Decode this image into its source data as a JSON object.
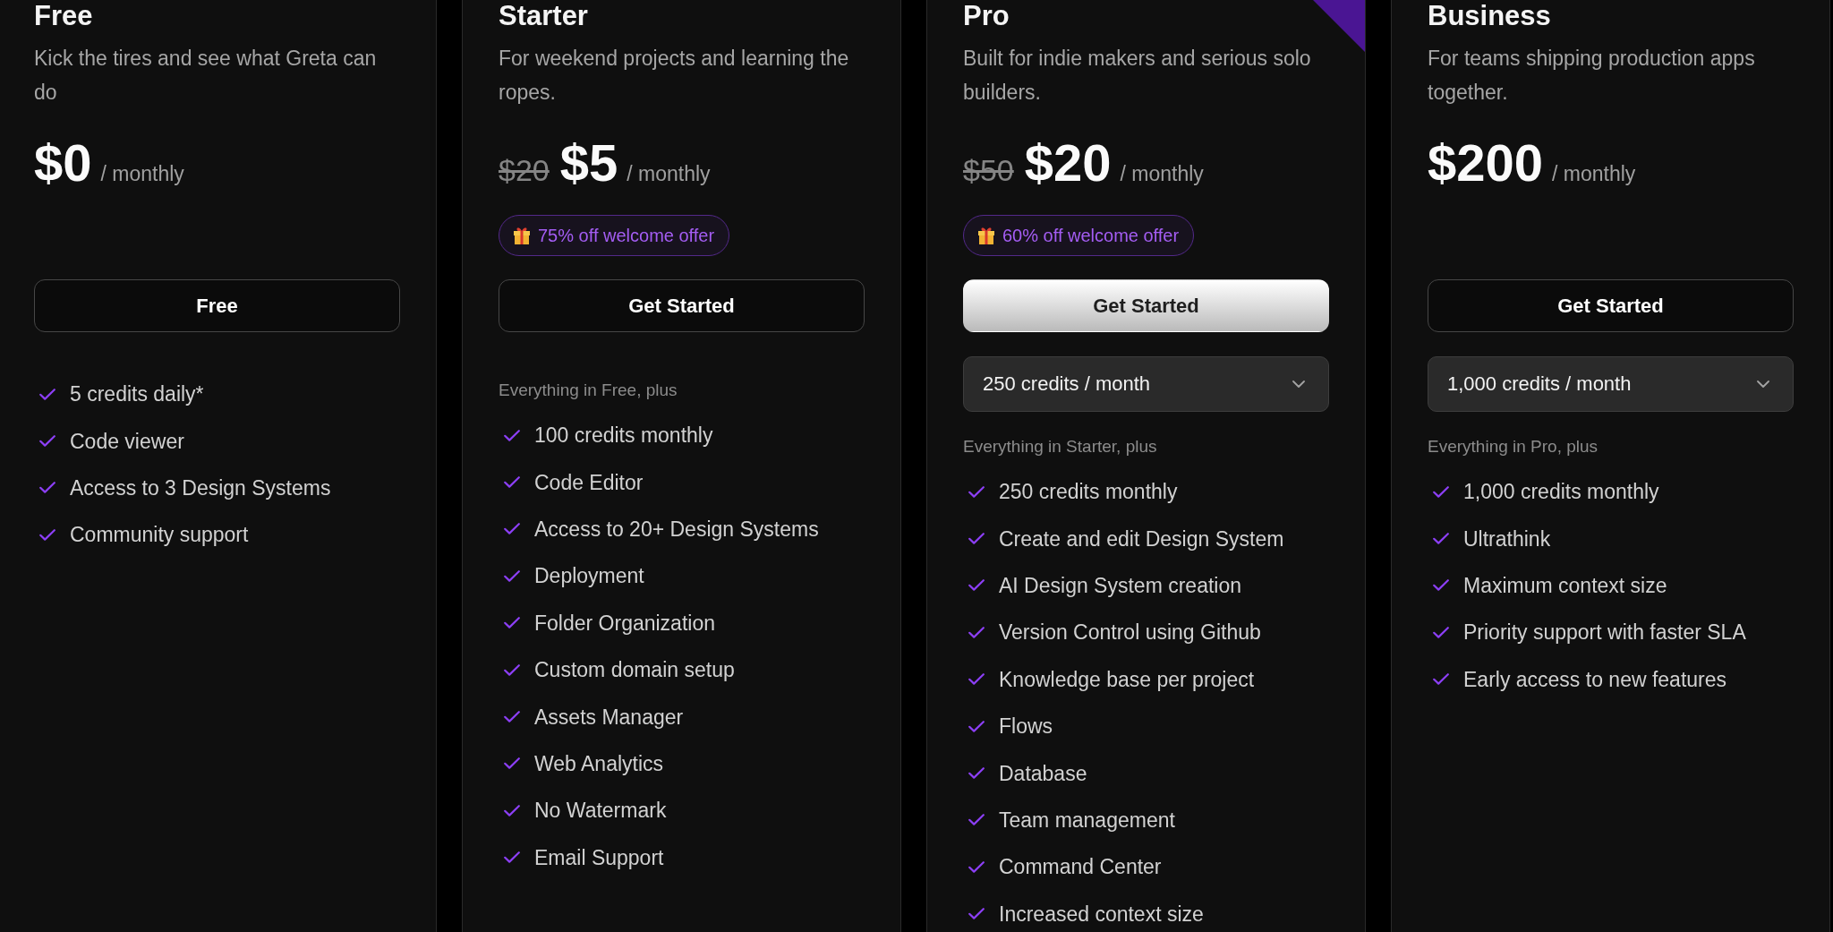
{
  "plans": [
    {
      "name": "Free",
      "description": "Kick the tires and see what Greta can do",
      "price": "$0",
      "period": "/ monthly",
      "featured": false,
      "button": "Free",
      "features": [
        "5 credits daily*",
        "Code viewer",
        "Access to 3 Design Systems",
        "Community support"
      ]
    },
    {
      "name": "Starter",
      "description": "For weekend projects and learning the ropes.",
      "original_price": "$20",
      "price": "$5",
      "period": "/ monthly",
      "offer": "75% off welcome offer",
      "featured": false,
      "button": "Get Started",
      "includes": "Everything in Free, plus",
      "features": [
        "100 credits monthly",
        "Code Editor",
        "Access to 20+ Design Systems",
        "Deployment",
        "Folder Organization",
        "Custom domain setup",
        "Assets Manager",
        "Web Analytics",
        "No Watermark",
        "Email Support"
      ]
    },
    {
      "name": "Pro",
      "description": "Built for indie makers and serious solo builders.",
      "original_price": "$50",
      "price": "$20",
      "period": "/ monthly",
      "offer": "60% off welcome offer",
      "featured": true,
      "button": "Get Started",
      "credits_select": "250 credits / month",
      "includes": "Everything in Starter, plus",
      "features": [
        "250 credits monthly",
        "Create and edit Design System",
        "AI Design System creation",
        "Version Control using Github",
        "Knowledge base per project",
        "Flows",
        "Database",
        "Team management",
        "Command Center",
        "Increased context size"
      ]
    },
    {
      "name": "Business",
      "description": "For teams shipping production apps together.",
      "price": "$200",
      "period": "/ monthly",
      "featured": false,
      "button": "Get Started",
      "credits_select": "1,000 credits / month",
      "includes": "Everything in Pro, plus",
      "features": [
        "1,000 credits monthly",
        "Ultrathink",
        "Maximum context size",
        "Priority support with faster SLA",
        "Early access to new features"
      ]
    }
  ]
}
